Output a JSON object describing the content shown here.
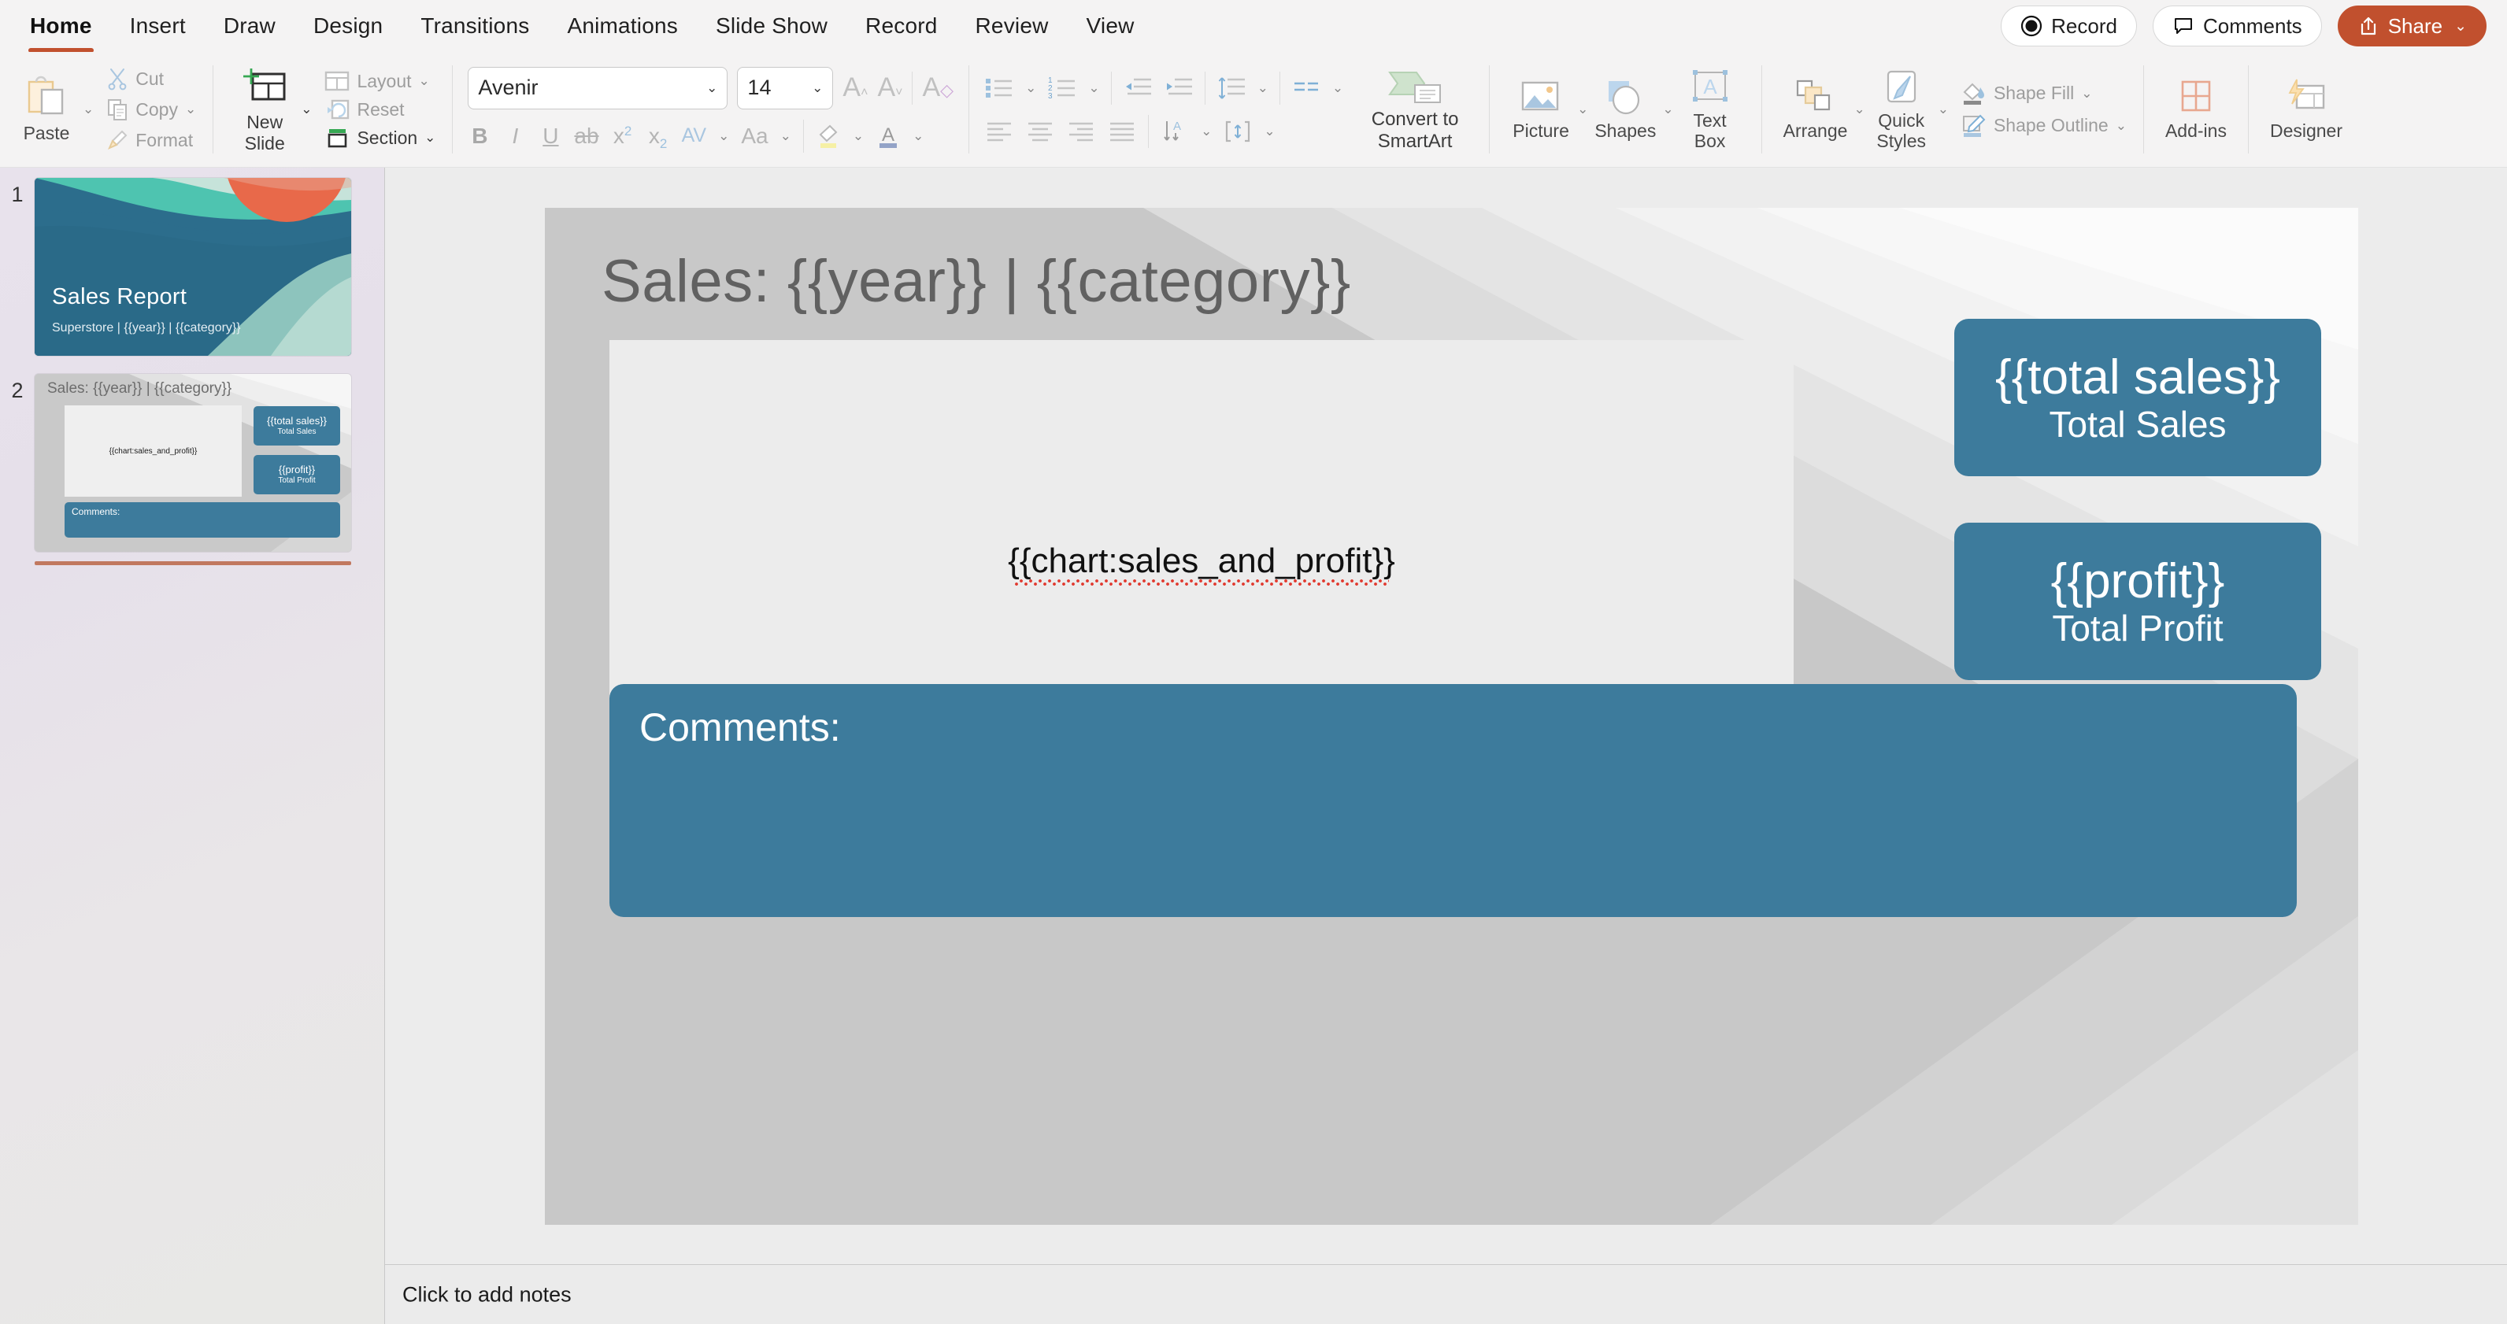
{
  "menu": {
    "tabs": [
      {
        "label": "Home",
        "active": true
      },
      {
        "label": "Insert",
        "active": false
      },
      {
        "label": "Draw",
        "active": false
      },
      {
        "label": "Design",
        "active": false
      },
      {
        "label": "Transitions",
        "active": false
      },
      {
        "label": "Animations",
        "active": false
      },
      {
        "label": "Slide Show",
        "active": false
      },
      {
        "label": "Record",
        "active": false
      },
      {
        "label": "Review",
        "active": false
      },
      {
        "label": "View",
        "active": false
      }
    ],
    "record_label": "Record",
    "comments_label": "Comments",
    "share_label": "Share",
    "share_chevron": "⌄"
  },
  "ribbon": {
    "paste_label": "Paste",
    "cut_label": "Cut",
    "copy_label": "Copy",
    "format_label": "Format",
    "new_slide_label_line1": "New",
    "new_slide_label_line2": "Slide",
    "layout_label": "Layout",
    "reset_label": "Reset",
    "section_label": "Section",
    "font_name": "Avenir",
    "font_size": "14",
    "grow_font": "A",
    "shrink_font": "A",
    "clear_format": "A",
    "bold": "B",
    "italic": "I",
    "underline": "U",
    "strikethrough": "ab",
    "superscript": "x",
    "subscript": "x",
    "char_spacing": "AV",
    "change_case": "Aa",
    "convert_smartart_line1": "Convert to",
    "convert_smartart_line2": "SmartArt",
    "picture_label": "Picture",
    "shapes_label": "Shapes",
    "textbox_line1": "Text",
    "textbox_line2": "Box",
    "arrange_label": "Arrange",
    "quickstyles_line1": "Quick",
    "quickstyles_line2": "Styles",
    "shape_fill_label": "Shape Fill",
    "shape_outline_label": "Shape Outline",
    "addins_label": "Add-ins",
    "designer_label": "Designer",
    "chevron": "⌄"
  },
  "slides_panel": {
    "slide1": {
      "number": "1",
      "title": "Sales Report",
      "subtitle": "Superstore | {{year}} | {{category}}"
    },
    "slide2": {
      "number": "2",
      "title": "Sales: {{year}} | {{category}}",
      "chart_placeholder": "{{chart:sales_and_profit}}",
      "card1_value": "{{total sales}}",
      "card1_label": "Total Sales",
      "card2_value": "{{profit}}",
      "card2_label": "Total Profit",
      "comments_label": "Comments:",
      "selected": true
    }
  },
  "slide": {
    "title": "Sales: {{year}} | {{category}}",
    "chart_placeholder": "{{chart:sales_and_profit}}",
    "stat1_value": "{{total sales}}",
    "stat1_label": "Total Sales",
    "stat2_value": "{{profit}}",
    "stat2_label": "Total Profit",
    "comments_label": "Comments:"
  },
  "notes": {
    "placeholder": "Click to add notes"
  },
  "colors": {
    "accent_orange": "#c1502e",
    "card_blue": "#3d7b9c",
    "slide_bg": "#c8c8c8",
    "chart_bg": "#ececec",
    "selection_bar": "#c1785f"
  }
}
